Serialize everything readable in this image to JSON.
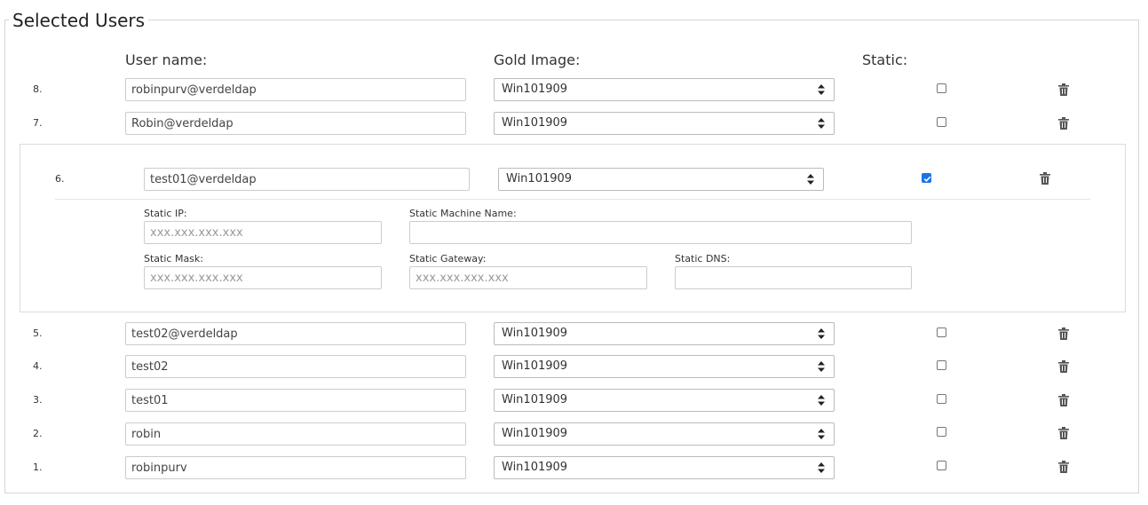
{
  "legend": "Selected Users",
  "headers": {
    "user_name": "User name:",
    "gold_image": "Gold Image:",
    "static": "Static:"
  },
  "rows": [
    {
      "num": "8.",
      "username": "robinpurv@verdeldap",
      "image": "Win101909",
      "static": false
    },
    {
      "num": "7.",
      "username": "Robin@verdeldap",
      "image": "Win101909",
      "static": false
    },
    {
      "num": "6.",
      "username": "test01@verdeldap",
      "image": "Win101909",
      "static": true
    },
    {
      "num": "5.",
      "username": "test02@verdeldap",
      "image": "Win101909",
      "static": false
    },
    {
      "num": "4.",
      "username": "test02",
      "image": "Win101909",
      "static": false
    },
    {
      "num": "3.",
      "username": "test01",
      "image": "Win101909",
      "static": false
    },
    {
      "num": "2.",
      "username": "robin",
      "image": "Win101909",
      "static": false
    },
    {
      "num": "1.",
      "username": "robinpurv",
      "image": "Win101909",
      "static": false
    }
  ],
  "static_config": {
    "ip": {
      "label": "Static IP:",
      "value": "",
      "placeholder": "xxx.xxx.xxx.xxx"
    },
    "machine_name": {
      "label": "Static Machine Name:",
      "value": "",
      "placeholder": ""
    },
    "mask": {
      "label": "Static Mask:",
      "value": "",
      "placeholder": "xxx.xxx.xxx.xxx"
    },
    "gateway": {
      "label": "Static Gateway:",
      "value": "",
      "placeholder": "xxx.xxx.xxx.xxx"
    },
    "dns": {
      "label": "Static DNS:",
      "value": "",
      "placeholder": ""
    }
  },
  "icons": {
    "delete": "trash-icon",
    "select": "select-arrows-icon",
    "checkmark": "checkmark-icon"
  },
  "colors": {
    "checkbox_checked": "#1a73e8",
    "border": "#cccccc"
  }
}
